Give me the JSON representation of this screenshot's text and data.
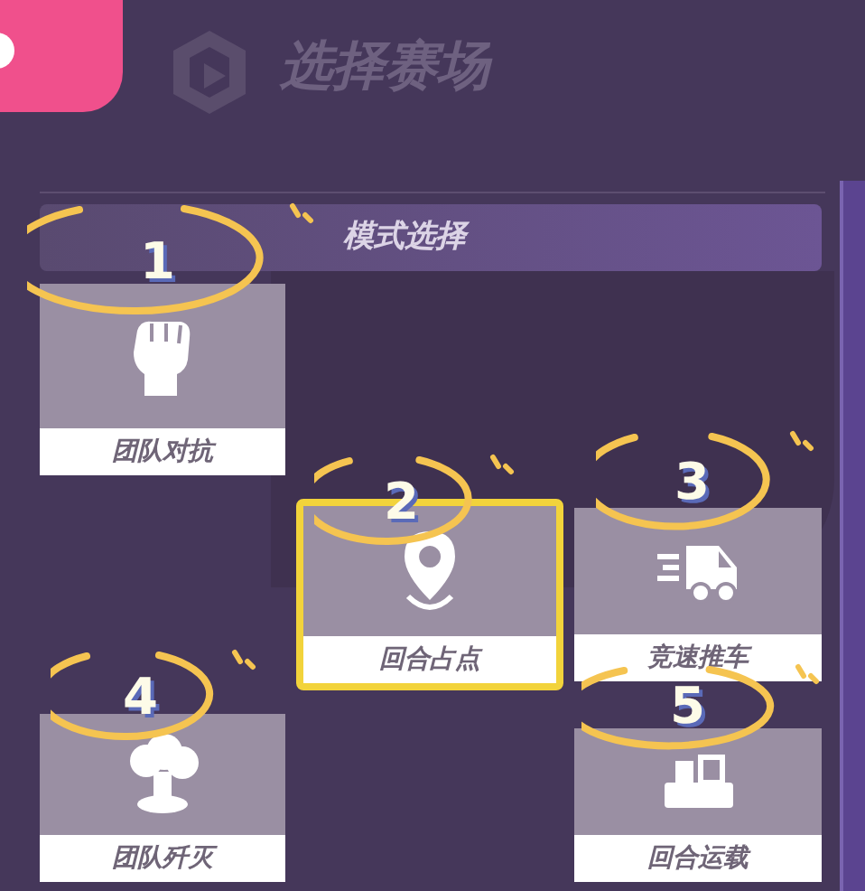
{
  "header": {
    "title": "选择赛场"
  },
  "section": {
    "title": "模式选择"
  },
  "modes": [
    {
      "label": "团队对抗",
      "kind": "fist",
      "selected": false,
      "annotation": "1"
    },
    {
      "label": "回合占点",
      "kind": "pin",
      "selected": true,
      "annotation": "2"
    },
    {
      "label": "竞速推车",
      "kind": "truck",
      "selected": false,
      "annotation": "3"
    },
    {
      "label": "团队歼灭",
      "kind": "blast",
      "selected": false,
      "annotation": "4"
    },
    {
      "label": "回合运载",
      "kind": "cart",
      "selected": false,
      "annotation": "5"
    }
  ]
}
